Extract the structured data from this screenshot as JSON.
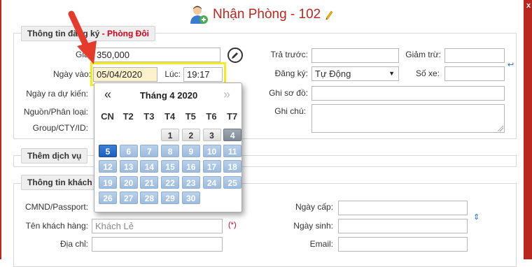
{
  "window": {
    "title": "Nhận Phòng - 102",
    "close_label": "x"
  },
  "registration": {
    "legend": "Thông tin đăng ký",
    "legend_sep": " - ",
    "legend_room": "Phòng Đôi",
    "price_label": "Giá:",
    "price_value": "350,000",
    "checkin_label": "Ngày vào:",
    "checkin_date": "05/04/2020",
    "time_label": "Lúc:",
    "checkin_time": "19:17",
    "checkout_label": "Ngày ra dự kiến:",
    "source_label": "Nguồn/Phân loại:",
    "group_label": "Group/CTY/ID:",
    "prepaid_label": "Trả trước:",
    "discount_label": "Giảm trừ:",
    "register_label": "Đăng ký:",
    "register_value": "Tự Động",
    "vehicle_label": "Số xe:",
    "map_label": "Ghi sơ đồ:",
    "note_label": "Ghi chú:"
  },
  "services": {
    "legend": "Thêm dịch vụ"
  },
  "guest": {
    "legend": "Thông tin khách",
    "id_label": "CMND/Passport:",
    "name_label": "Tên khách hàng:",
    "name_placeholder": "Khách Lẻ",
    "required_mark": "(*)",
    "address_label": "Địa chỉ:",
    "issue_date_label": "Ngày cấp:",
    "birth_date_label": "Ngày sinh:",
    "email_label": "Email:"
  },
  "calendar": {
    "title": "Tháng 4 2020",
    "prev": "«",
    "next": "»",
    "weekdays": [
      "CN",
      "T2",
      "T3",
      "T4",
      "T5",
      "T6",
      "T7"
    ],
    "first_weekday_index": 3,
    "days_in_month": 30,
    "today": 4,
    "selected": 5
  },
  "colors": {
    "accent": "#b9271f",
    "highlight": "#f3ee19",
    "annotation_arrow": "#e53b2c"
  }
}
